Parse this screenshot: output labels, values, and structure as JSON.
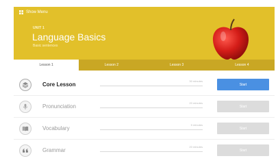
{
  "header": {
    "menu_label": "Show Menu",
    "unit_label": "UNIT 1",
    "title": "Language Basics",
    "subtitle": "Basic sentences"
  },
  "tabs": [
    {
      "label": "Lesson 1",
      "active": true
    },
    {
      "label": "Lesson 2",
      "active": false
    },
    {
      "label": "Lesson 3",
      "active": false
    },
    {
      "label": "Lesson 4",
      "active": false
    }
  ],
  "lessons": [
    {
      "name": "Core Lesson",
      "duration": "30 minutes",
      "start_label": "Start",
      "icon": "layers-icon",
      "active": true,
      "progress": 0
    },
    {
      "name": "Pronunciation",
      "duration": "20 minutes",
      "start_label": "Start",
      "icon": "microphone-icon",
      "active": false,
      "progress": 0
    },
    {
      "name": "Vocabulary",
      "duration": "5 minutes",
      "start_label": "Start",
      "icon": "book-icon",
      "active": false,
      "progress": 0
    },
    {
      "name": "Grammar",
      "duration": "20 minutes",
      "start_label": "Start",
      "icon": "quote-icon",
      "active": false,
      "progress": 0
    }
  ],
  "colors": {
    "hero": "#e2c02a",
    "tab_bar": "#c9a724",
    "accent": "#4a90e2"
  }
}
